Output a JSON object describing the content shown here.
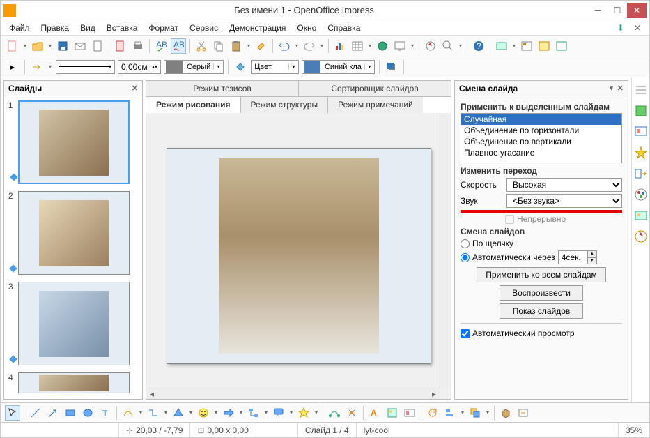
{
  "window": {
    "title": "Без имени 1 - OpenOffice Impress"
  },
  "menu": {
    "file": "Файл",
    "edit": "Правка",
    "view": "Вид",
    "insert": "Вставка",
    "format": "Формат",
    "tools": "Сервис",
    "slideshow": "Демонстрация",
    "window": "Окно",
    "help": "Справка"
  },
  "toolbar2": {
    "line_width": "0,00см",
    "gray_label": "Серый",
    "color_label": "Цвет",
    "blue_label": "Синий кла"
  },
  "slides_panel": {
    "title": "Слайды"
  },
  "tabs": {
    "outline_view": "Режим тезисов",
    "sorter": "Сортировщик слайдов",
    "drawing": "Режим рисования",
    "structure": "Режим структуры",
    "notes": "Режим примечаний"
  },
  "task": {
    "title": "Смена слайда",
    "apply_label": "Применить к выделенным слайдам",
    "transitions": [
      "Случайная",
      "Объединение по горизонтали",
      "Объединение по вертикали",
      "Плавное угасание"
    ],
    "modify_label": "Изменить переход",
    "speed_label": "Скорость",
    "speed_value": "Высокая",
    "sound_label": "Звук",
    "sound_value": "<Без звука>",
    "loop_label": "Непрерывно",
    "advance_label": "Смена слайдов",
    "on_click": "По щелчку",
    "auto_after": "Автоматически через",
    "auto_value": "4сек.",
    "apply_all": "Применить ко всем слайдам",
    "play": "Воспроизвести",
    "show": "Показ слайдов",
    "auto_preview": "Автоматический просмотр"
  },
  "status": {
    "coords": "20,03 / -7,79",
    "size": "0,00 x 0,00",
    "slide": "Слайд 1 / 4",
    "template": "lyt-cool",
    "zoom": "35%"
  }
}
